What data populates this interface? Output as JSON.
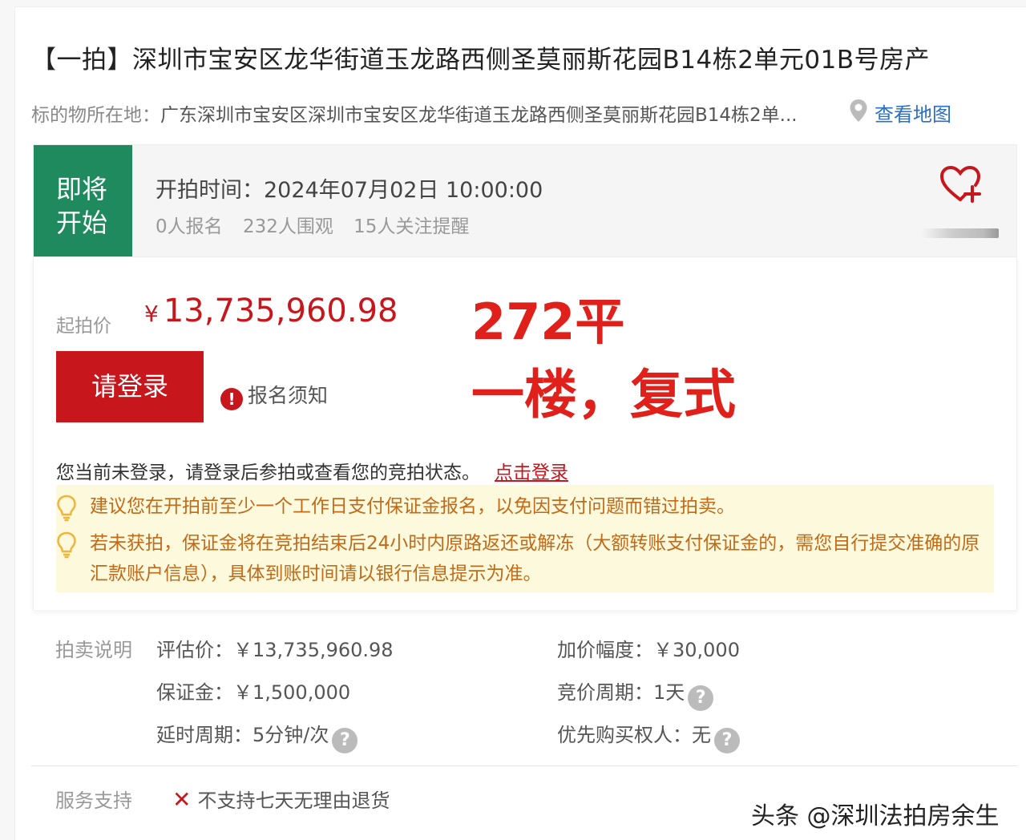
{
  "header": {
    "title": "【一拍】深圳市宝安区龙华街道玉龙路西侧圣莫丽斯花园B14栋2单元01B号房产",
    "location_label": "标的物所在地：",
    "location_value": "广东深圳市宝安区深圳市宝安区龙华街道玉龙路西侧圣莫丽斯花园B14栋2单...",
    "map_link": "查看地图"
  },
  "status": {
    "badge_line1": "即将",
    "badge_line2": "开始",
    "start_time": "开拍时间：2024年07月02日 10:00:00",
    "signups": "0人报名",
    "viewers": "232人围观",
    "followers": "15人关注提醒"
  },
  "price": {
    "label": "起拍价",
    "currency": "¥",
    "value": "13,735,960.98"
  },
  "overlay": {
    "area": "272平",
    "floor": "一楼，复式"
  },
  "actions": {
    "login_button": "请登录",
    "notice": "报名须知",
    "login_hint": "您当前未登录，请登录后参拍或查看您的竞拍状态。",
    "login_link": "点击登录"
  },
  "tips": [
    "建议您在开拍前至少一个工作日支付保证金报名，以免因支付问题而错过拍卖。",
    "若未获拍，保证金将在竞拍结束后24小时内原路返还或解冻（大额转账支付保证金的，需您自行提交准确的原汇款账户信息），具体到账时间请以银行信息提示为准。"
  ],
  "auction_info": {
    "label": "拍卖说明",
    "appraisal": "评估价：￥13,735,960.98",
    "increment": "加价幅度：￥30,000",
    "deposit": "保证金：￥1,500,000",
    "cycle": "竞价周期：1天",
    "extension": "延时周期：5分钟/次",
    "preemption": "优先购买权人：无"
  },
  "service": {
    "label": "服务支持",
    "item": "不支持七天无理由退货"
  },
  "watermark": "头条 @深圳法拍房余生",
  "colors": {
    "accent_red": "#c8161d",
    "badge_green": "#1e8a5d",
    "link_blue": "#2a6ec8",
    "tip_bg": "#fdf9dc",
    "tip_text": "#c06a1a"
  },
  "icons": [
    "pin-icon",
    "heart-plus-icon",
    "warning-icon",
    "bulb-icon",
    "question-icon",
    "x-icon"
  ]
}
